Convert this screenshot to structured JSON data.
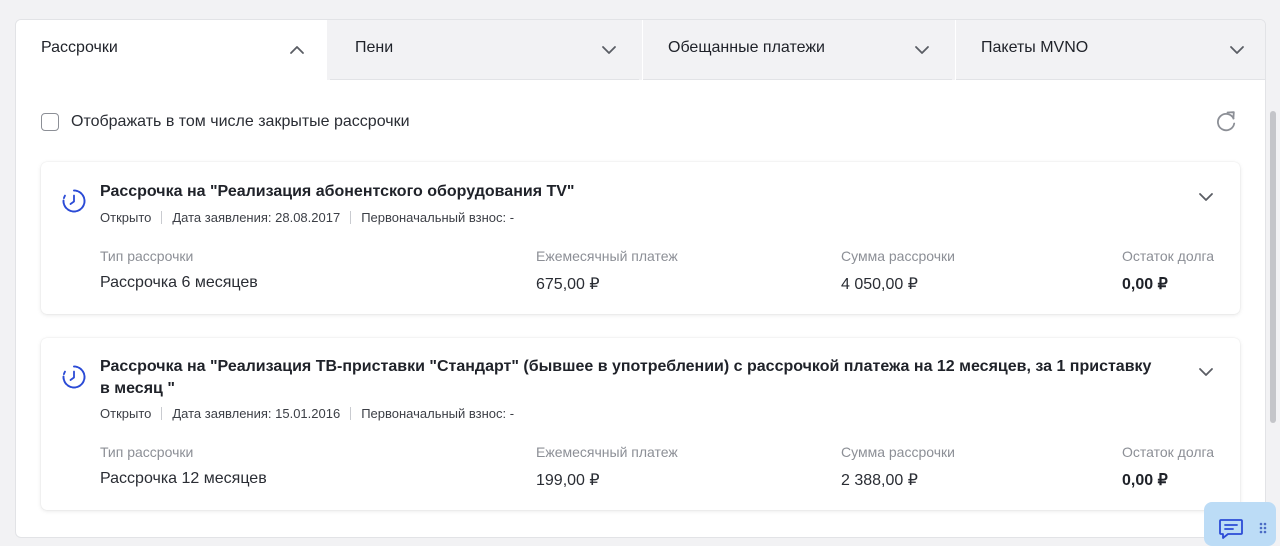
{
  "tabs": [
    {
      "label": "Рассрочки",
      "expanded": true
    },
    {
      "label": "Пени",
      "expanded": false
    },
    {
      "label": "Обещанные платежи",
      "expanded": false
    },
    {
      "label": "Пакеты MVNO",
      "expanded": false
    }
  ],
  "filter": {
    "label": "Отображать в том числе закрытые рассрочки",
    "checked": false
  },
  "cards": [
    {
      "title": "Рассрочка на \"Реализация абонентского оборудования TV\"",
      "status": "Открыто",
      "date": "Дата заявления: 28.08.2017",
      "down_payment": "Первоначальный взнос: -",
      "type_label": "Тип рассрочки",
      "type_value": "Рассрочка 6 месяцев",
      "monthly_label": "Ежемесячный платеж",
      "monthly_value": "675,00 ₽",
      "sum_label": "Сумма рассрочки",
      "sum_value": "4 050,00 ₽",
      "debt_label": "Остаток долга",
      "debt_value": "0,00 ₽"
    },
    {
      "title": "Рассрочка на \"Реализация ТВ-приставки \"Стандарт\" (бывшее в употреблении) с рассрочкой платежа на 12 месяцев, за 1 приставку в месяц \"",
      "status": "Открыто",
      "date": "Дата заявления: 15.01.2016",
      "down_payment": "Первоначальный взнос: -",
      "type_label": "Тип рассрочки",
      "type_value": "Рассрочка 12 месяцев",
      "monthly_label": "Ежемесячный платеж",
      "monthly_value": "199,00 ₽",
      "sum_label": "Сумма рассрочки",
      "sum_value": "2 388,00 ₽",
      "debt_label": "Остаток долга",
      "debt_value": "0,00 ₽"
    }
  ],
  "icons": {
    "chevron": "chevron-icon",
    "refresh": "refresh-icon",
    "clock": "clock-icon",
    "chat": "chat-icon",
    "drag": "drag-handle-icon"
  },
  "colors": {
    "accent": "#2b4bd6",
    "muted": "#8c8f96",
    "chat_button": "#bcdcf6"
  }
}
